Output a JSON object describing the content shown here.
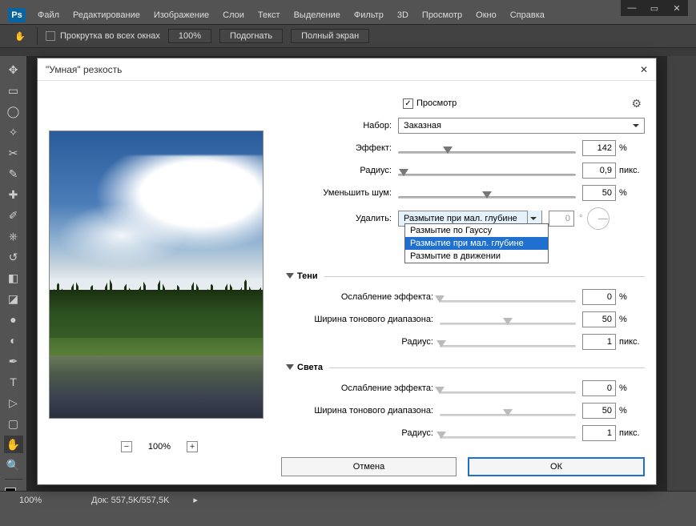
{
  "app_logo": "Ps",
  "menu": [
    "Файл",
    "Редактирование",
    "Изображение",
    "Слои",
    "Текст",
    "Выделение",
    "Фильтр",
    "3D",
    "Просмотр",
    "Окно",
    "Справка"
  ],
  "optionbar": {
    "scroll_all_label": "Прокрутка во всех окнах",
    "btn_100": "100%",
    "btn_fit": "Подогнать",
    "btn_fullscreen": "Полный экран"
  },
  "status": {
    "zoom": "100%",
    "doc": "Док: 557,5K/557,5K"
  },
  "dialog": {
    "title": "\"Умная\" резкость",
    "preview_label": "Просмотр",
    "preset_label": "Набор:",
    "preset_value": "Заказная",
    "effect_label": "Эффект:",
    "effect_value": "142",
    "radius_label": "Радиус:",
    "radius_value": "0,9",
    "noise_label": "Уменьшить шум:",
    "noise_value": "50",
    "remove_label": "Удалить:",
    "remove_value": "Размытие при мал. глубине",
    "remove_options": [
      "Размытие по Гауссу",
      "Размытие при мал. глубине",
      "Размытие в движении"
    ],
    "angle_value": "0",
    "unit_pct": "%",
    "unit_px": "пикс.",
    "section_shadows": "Тени",
    "section_highlights": "Света",
    "fade_label": "Ослабление эффекта:",
    "tonal_label": "Ширина тонового диапазона:",
    "radius2_label": "Радиус:",
    "sh_fade": "0",
    "sh_tonal": "50",
    "sh_radius": "1",
    "hi_fade": "0",
    "hi_tonal": "50",
    "hi_radius": "1",
    "zoom_pct": "100%",
    "btn_cancel": "Отмена",
    "btn_ok": "ОК"
  }
}
